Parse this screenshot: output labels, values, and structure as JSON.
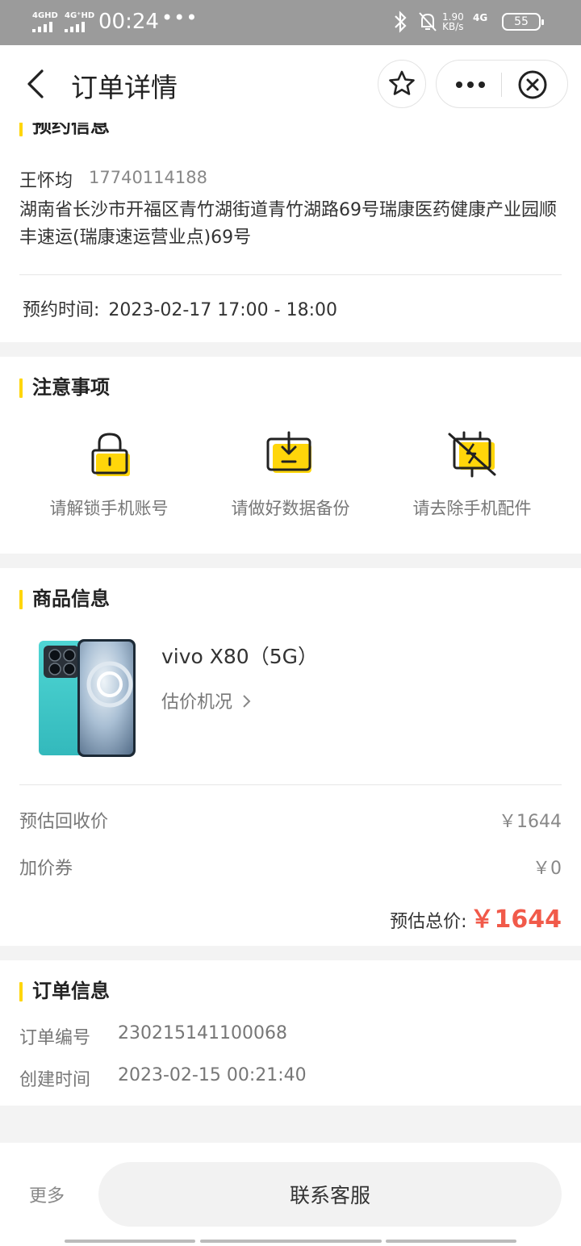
{
  "status_bar": {
    "signal1": "4GHD",
    "signal2": "4G⁺HD",
    "time": "00:24",
    "dots": "•••",
    "net_speed_value": "1.90",
    "net_speed_unit": "KB/s",
    "network": "4G",
    "battery": "55"
  },
  "header": {
    "title": "订单详情"
  },
  "appointment": {
    "section_title": "预约信息",
    "name": "王怀均",
    "phone": "17740114188",
    "address": "湖南省长沙市开福区青竹湖街道青竹湖路69号瑞康医药健康产业园顺丰速运(瑞康速运营业点)69号",
    "time_label": "预约时间:",
    "time_value": "2023-02-17 17:00 - 18:00"
  },
  "notice": {
    "section_title": "注意事项",
    "items": [
      {
        "label": "请解锁手机账号",
        "icon": "unlock-icon"
      },
      {
        "label": "请做好数据备份",
        "icon": "backup-icon"
      },
      {
        "label": "请去除手机配件",
        "icon": "accessory-removal-icon"
      }
    ],
    "accent_color": "#ffd60a"
  },
  "product": {
    "section_title": "商品信息",
    "name": "vivo X80（5G）",
    "assess_link": "估价机况",
    "recycle_label": "预估回收价",
    "recycle_value": "￥1644",
    "coupon_label": "加价券",
    "coupon_value": "￥0",
    "total_label": "预估总价:",
    "total_value": "￥1644",
    "price_color": "#f15a4a"
  },
  "order": {
    "section_title": "订单信息",
    "number_label": "订单编号",
    "number_value": "230215141100068",
    "created_label": "创建时间",
    "created_value": "2023-02-15 00:21:40"
  },
  "bottom": {
    "more_label": "更多",
    "service_label": "联系客服"
  }
}
